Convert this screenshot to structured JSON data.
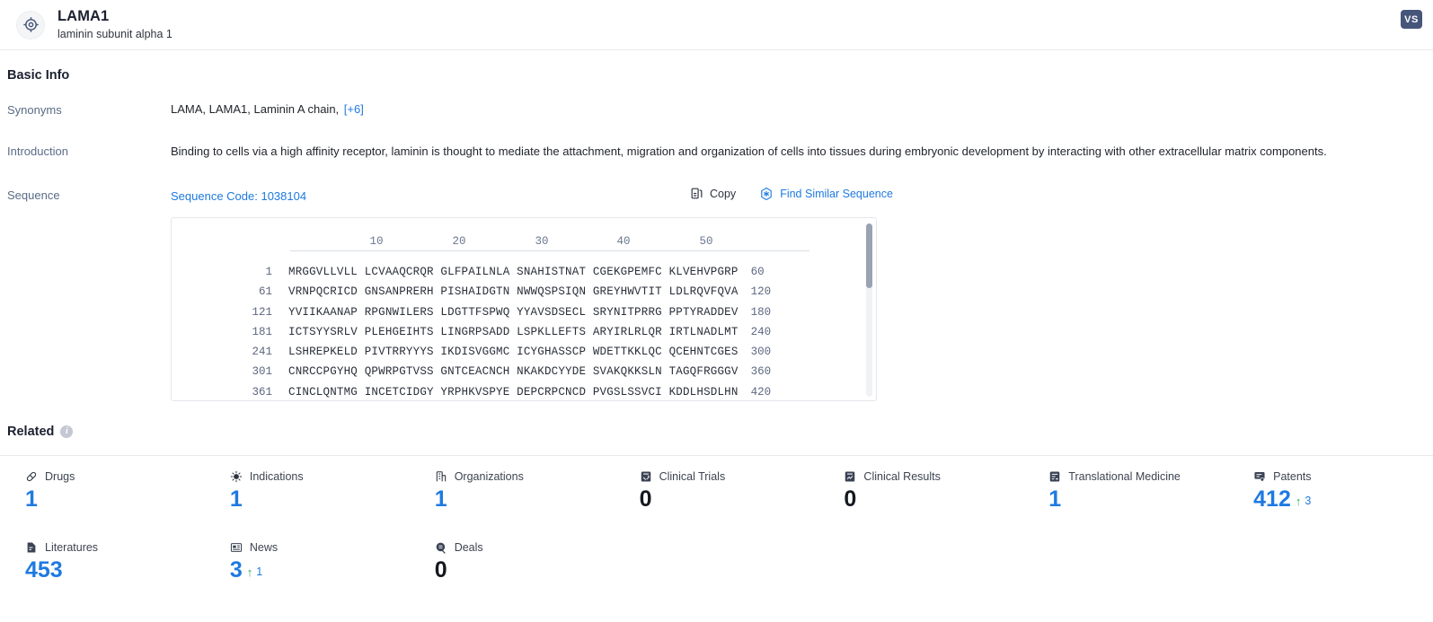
{
  "header": {
    "icon": "target-icon",
    "title": "LAMA1",
    "subtitle": "laminin subunit alpha 1",
    "badge": "VS"
  },
  "basic_info": {
    "section_title": "Basic Info",
    "synonyms": {
      "label": "Synonyms",
      "value": "LAMA,  LAMA1,  Laminin A chain,",
      "more": "[+6]"
    },
    "introduction": {
      "label": "Introduction",
      "text": "Binding to cells via a high affinity receptor, laminin is thought to mediate the attachment, migration and organization of cells into tissues during embryonic development by interacting with other extracellular matrix components."
    },
    "sequence": {
      "label": "Sequence",
      "code_label": "Sequence Code: 1038104",
      "copy_label": "Copy",
      "find_similar_label": "Find Similar Sequence",
      "ruler_ticks": [
        "10",
        "20",
        "30",
        "40",
        "50"
      ],
      "lines": [
        {
          "start": "1",
          "chunks": "MRGGVLLVLL LCVAAQCRQR GLFPAILNLA SNAHISTNAT CGEKGPEMFC KLVEHVPGRP",
          "end": "60"
        },
        {
          "start": "61",
          "chunks": "VRNPQCRICD GNSANPRERH PISHAIDGTN NWWQSPSIQN GREYHWVTIT LDLRQVFQVA",
          "end": "120"
        },
        {
          "start": "121",
          "chunks": "YVIIKAANAP RPGNWILERS LDGTTFSPWQ YYAVSDSECL SRYNITPRRG PPTYRADDEV",
          "end": "180"
        },
        {
          "start": "181",
          "chunks": "ICTSYYSRLV PLEHGEIHTS LINGRPSADD LSPKLLEFTS ARYIRLRLQR IRTLNADLMT",
          "end": "240"
        },
        {
          "start": "241",
          "chunks": "LSHREPKELD PIVTRRYYYS IKDISVGGMC ICYGHASSCP WDETTKKLQC QCEHNTCGES",
          "end": "300"
        },
        {
          "start": "301",
          "chunks": "CNRCCPGYHQ QPWRPGTVSS GNTCEACNCH NKAKDCYYDE SVAKQKKSLN TAGQFRGGGV",
          "end": "360"
        },
        {
          "start": "361",
          "chunks": "CINCLQNTMG INCETCIDGY YRPHKVSPYE DEPCRPCNCD PVGSLSSVCI KDDLHSDLHN",
          "end": "420"
        }
      ]
    }
  },
  "related": {
    "title": "Related",
    "info_icon": "info-icon",
    "tiles_row1": [
      {
        "icon": "drug-capsule-icon",
        "label": "Drugs",
        "value": "1",
        "value_style": "blue",
        "delta": null
      },
      {
        "icon": "virus-icon",
        "label": "Indications",
        "value": "1",
        "value_style": "blue",
        "delta": null
      },
      {
        "icon": "organization-building-icon",
        "label": "Organizations",
        "value": "1",
        "value_style": "blue",
        "delta": null
      },
      {
        "icon": "clinical-trial-icon",
        "label": "Clinical Trials",
        "value": "0",
        "value_style": "zero",
        "delta": null
      },
      {
        "icon": "clinical-result-icon",
        "label": "Clinical Results",
        "value": "0",
        "value_style": "zero",
        "delta": null
      },
      {
        "icon": "translational-medicine-icon",
        "label": "Translational Medicine",
        "value": "1",
        "value_style": "blue",
        "delta": null
      },
      {
        "icon": "patent-icon",
        "label": "Patents",
        "value": "412",
        "value_style": "blue",
        "delta": "3"
      }
    ],
    "tiles_row2": [
      {
        "icon": "literature-icon",
        "label": "Literatures",
        "value": "453",
        "value_style": "blue",
        "delta": null
      },
      {
        "icon": "news-icon",
        "label": "News",
        "value": "3",
        "value_style": "blue",
        "delta": "1"
      },
      {
        "icon": "deals-icon",
        "label": "Deals",
        "value": "0",
        "value_style": "zero",
        "delta": null
      }
    ]
  },
  "colors": {
    "accent_blue": "#1f7ae0",
    "delta_green": "#33a852",
    "badge_slate": "#46557a",
    "label_gray": "#5a6b86"
  }
}
